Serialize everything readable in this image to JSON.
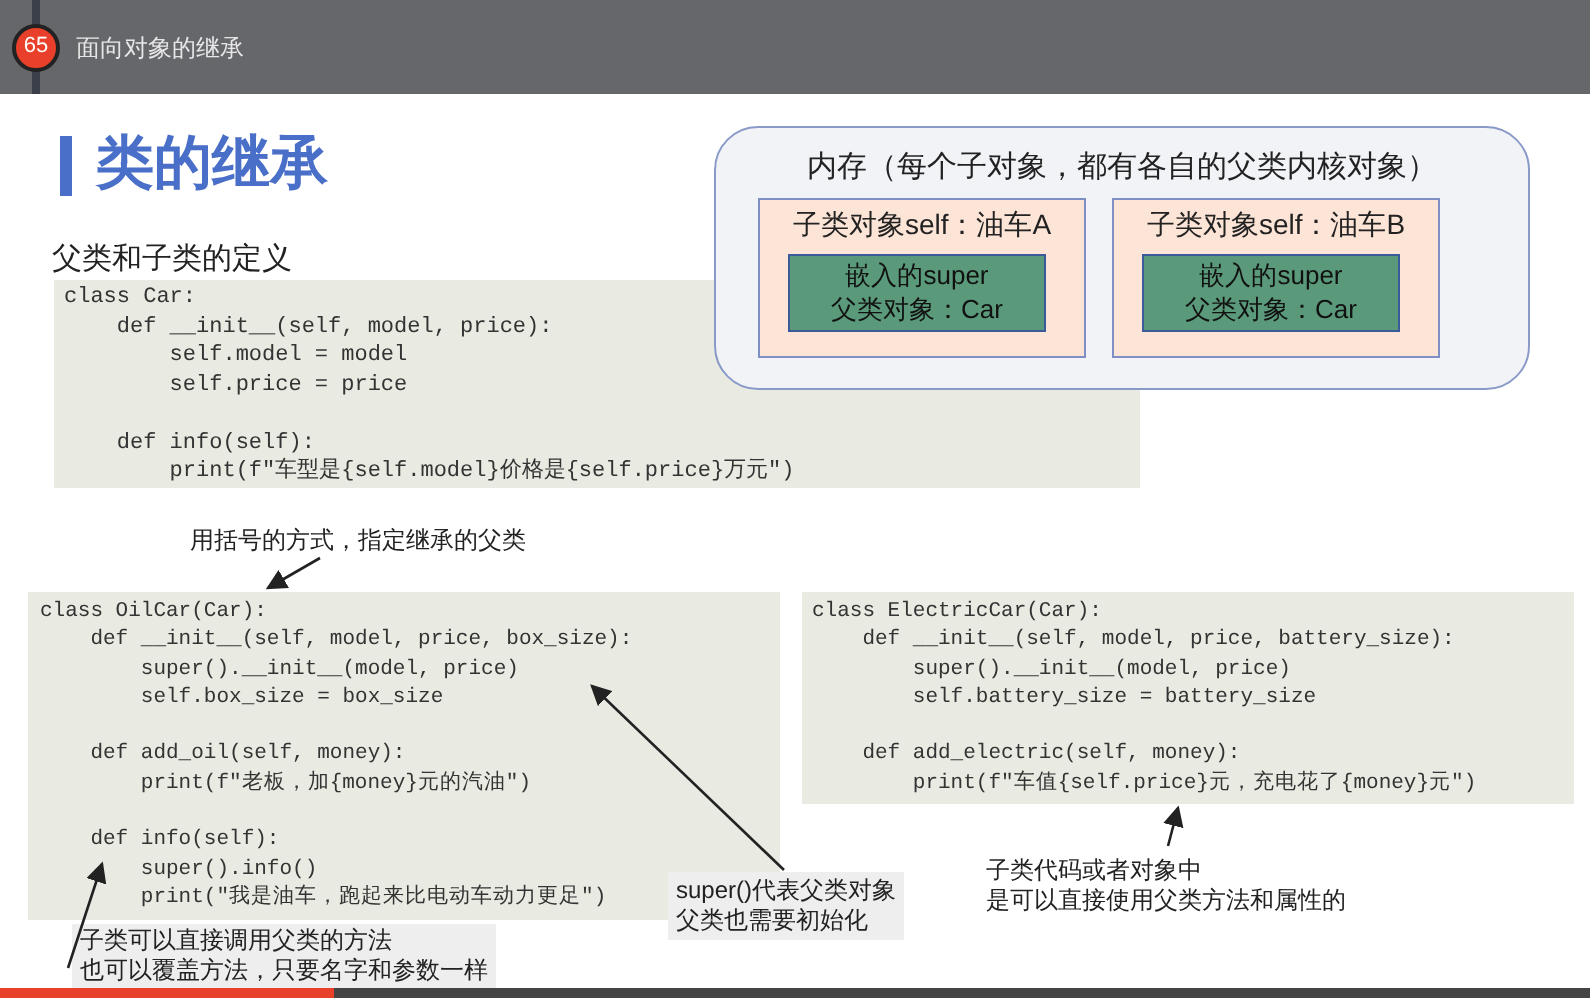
{
  "header": {
    "lesson_number": "65",
    "title": "面向对象的继承"
  },
  "slide": {
    "title": "类的继承",
    "subtitle": "父类和子类的定义",
    "memory": {
      "title": "内存（每个子对象，都有各自的父类内核对象）",
      "objects": [
        {
          "label": "子类对象self：油车A",
          "inner_lines": [
            "嵌入的super",
            "父类对象：Car"
          ]
        },
        {
          "label": "子类对象self：油车B",
          "inner_lines": [
            "嵌入的super",
            "父类对象：Car"
          ]
        }
      ]
    },
    "code_blocks": [
      {
        "sections": [
          [
            "class Car:",
            "    def __init__(self, model, price):",
            "        self.model = model",
            "        self.price = price"
          ],
          [
            "    def info(self):",
            "        print(f\"车型是{self.model}价格是{self.price}万元\")"
          ]
        ]
      },
      {
        "sections": [
          [
            "class OilCar(Car):",
            "    def __init__(self, model, price, box_size):",
            "        super().__init__(model, price)",
            "        self.box_size = box_size"
          ],
          [
            "    def add_oil(self, money):",
            "        print(f\"老板，加{money}元的汽油\")"
          ],
          [
            "    def info(self):",
            "        super().info()",
            "        print(\"我是油车，跑起来比电动车动力更足\")"
          ]
        ]
      },
      {
        "sections": [
          [
            "class ElectricCar(Car):",
            "    def __init__(self, model, price, battery_size):",
            "        super().__init__(model, price)",
            "        self.battery_size = battery_size"
          ],
          [
            "    def add_electric(self, money):",
            "        print(f\"车值{self.price}元，充电花了{money}元\")"
          ]
        ]
      }
    ],
    "notes": [
      {
        "lines": [
          "用括号的方式，指定继承的父类"
        ]
      },
      {
        "lines": [
          "super()代表父类对象",
          "父类也需要初始化"
        ]
      },
      {
        "lines": [
          "子类可以直接调用父类的方法",
          "也可以覆盖方法，只要名字和参数一样"
        ]
      },
      {
        "lines": [
          "子类代码或者对象中",
          "是可以直接使用父类方法和属性的"
        ]
      }
    ]
  },
  "progress": {
    "level": 0.21
  }
}
